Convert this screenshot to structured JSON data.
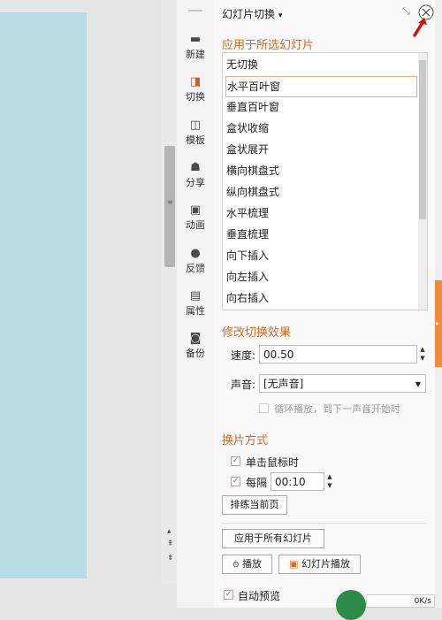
{
  "panel": {
    "title": "幻灯片切换",
    "title_caret": "▾",
    "apply_section_title": "应用于所选幻灯片",
    "transitions": [
      "无切换",
      "水平百叶窗",
      "垂直百叶窗",
      "盒状收缩",
      "盒状展开",
      "横向棋盘式",
      "纵向棋盘式",
      "水平梳理",
      "垂直梳理",
      "向下插入",
      "向左插入",
      "向右插入"
    ],
    "selected_transition": "水平百叶窗",
    "modify_section_title": "修改切换效果",
    "speed_label": "速度:",
    "speed_value": "00.50",
    "sound_label": "声音:",
    "sound_value": "[无声音]",
    "loop_label": "循环播放，到下一声音开始时",
    "switch_section_title": "换片方式",
    "on_click_label": "单击鼠标时",
    "on_click_checked": true,
    "every_label": "每隔",
    "every_checked": true,
    "every_value": "00:10",
    "rehearse_button": "排练当前页",
    "apply_all_button": "应用于所有幻灯片",
    "play_button": "播放",
    "slideshow_button": "幻灯片播放",
    "autopreview_label": "自动预览",
    "autopreview_checked": true,
    "status_percent": "0K/s"
  },
  "strip": [
    {
      "label": "新建",
      "icon": "new-doc-icon"
    },
    {
      "label": "切换",
      "icon": "transition-icon",
      "active": true
    },
    {
      "label": "模板",
      "icon": "template-icon"
    },
    {
      "label": "分享",
      "icon": "share-icon"
    },
    {
      "label": "动画",
      "icon": "animation-icon"
    },
    {
      "label": "反馈",
      "icon": "feedback-icon"
    },
    {
      "label": "属性",
      "icon": "properties-icon"
    },
    {
      "label": "备份",
      "icon": "backup-icon"
    }
  ],
  "colors": {
    "accent": "#d26a27",
    "slide": "#b5dde3",
    "orange_bar": "#ef8b3b",
    "annotation_red": "#cc1111"
  }
}
